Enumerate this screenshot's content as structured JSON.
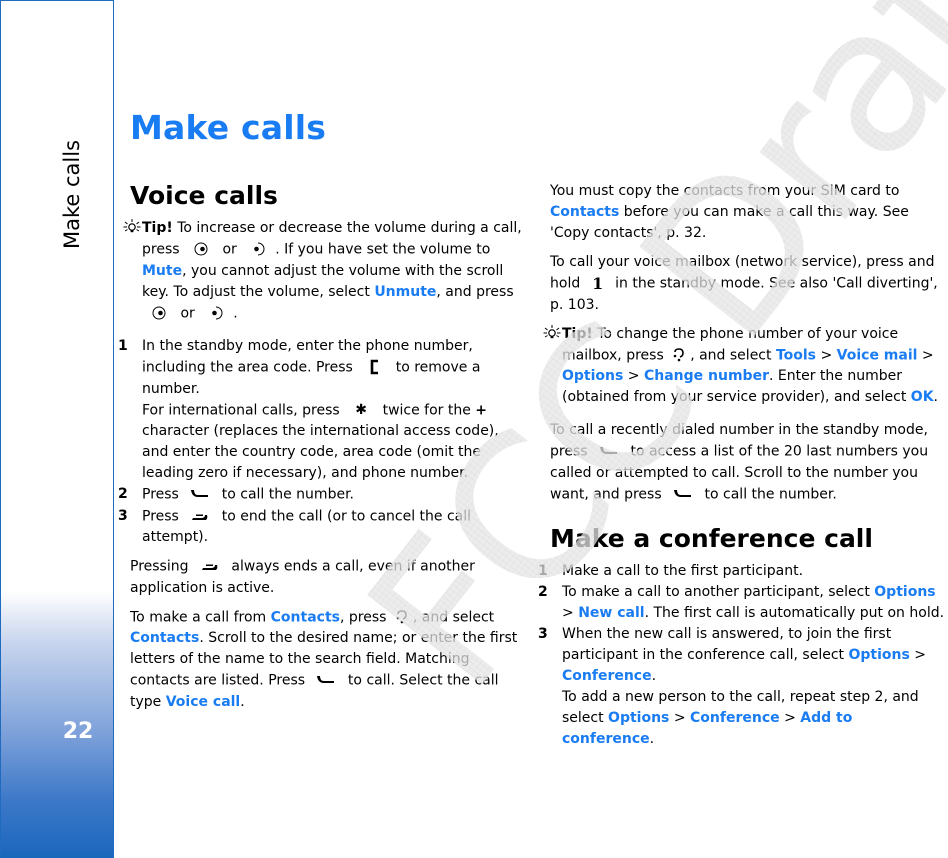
{
  "sidebar": {
    "chapter_title": "Make calls",
    "page_number": "22",
    "accent_color": "#1a66bd"
  },
  "page": {
    "title": "Make calls",
    "link_color": "#1a7cf2"
  },
  "watermark": {
    "text": "FCC Draft"
  },
  "left": {
    "heading": "Voice calls",
    "tip": {
      "icon": "lightbulb-icon",
      "label": "Tip!",
      "t1": " To increase or decrease the volume during a call, press ",
      "t2": " or ",
      "t3": ". If you have set the volume to ",
      "mute": "Mute",
      "t4": ", you cannot adjust the volume with the scroll key. To adjust the volume, select ",
      "unmute": "Unmute",
      "t5": ", and press ",
      "t6": " or ",
      "t7": "."
    },
    "steps": [
      {
        "num": "1",
        "a": "In the standby mode, enter the phone number, including the area code. Press ",
        "b": " to remove a number.",
        "c": "For international calls, press ",
        "d": " twice for the ",
        "plus": "+",
        "e": " character (replaces the international access code), and enter the country code, area code (omit the leading zero if necessary), and phone number."
      },
      {
        "num": "2",
        "a": "Press ",
        "b": " to call the number."
      },
      {
        "num": "3",
        "a": "Press ",
        "b": " to end the call (or to cancel the call attempt)."
      }
    ],
    "p_pressing": {
      "a": "Pressing ",
      "b": " always ends a call, even if another application is active."
    },
    "p_contacts": {
      "a": "To make a call from ",
      "contacts1": "Contacts",
      "b": ", press ",
      "c": ", and select ",
      "contacts2": "Contacts",
      "d": ". Scroll to the desired name; or enter the first letters of the name to the search field. Matching contacts are listed. Press ",
      "e": " to call. Select the call type ",
      "voice_call": "Voice call",
      "f": "."
    }
  },
  "right": {
    "p_sim": {
      "a": "You must copy the contacts from your SIM card to ",
      "contacts": "Contacts",
      "b": " before you can make a call this way. See 'Copy contacts', p. 32."
    },
    "p_mailbox": {
      "a": "To call your voice mailbox (network service), press and hold ",
      "key": "1",
      "b": " in the standby mode. See also 'Call diverting', p. 103."
    },
    "tip": {
      "label": "Tip!",
      "a": " To change the phone number of your voice mailbox, press ",
      "b": ", and select ",
      "tools": "Tools",
      "sep1": " > ",
      "voice_mail": "Voice mail",
      "sep2": " > ",
      "options": "Options",
      "sep3": " > ",
      "change_number": "Change number",
      "c": ". Enter the number (obtained from your service provider), and select ",
      "ok": "OK",
      "d": "."
    },
    "p_recent": {
      "a": "To call a recently dialed number in the standby mode, press ",
      "b": " to access a list of the 20 last numbers you called or attempted to call. Scroll to the number you want, and press ",
      "c": " to call the number."
    },
    "heading": "Make a conference call",
    "steps": [
      {
        "num": "1",
        "a": "Make a call to the first participant."
      },
      {
        "num": "2",
        "a": "To make a call to another participant, select ",
        "options": "Options",
        "sep": " > ",
        "new_call": "New call",
        "b": ". The first call is automatically put on hold."
      },
      {
        "num": "3",
        "a": "When the new call is answered, to join the first participant in the conference call, select ",
        "options": "Options",
        "sep": " > ",
        "conference": "Conference",
        "b": ".",
        "c": "To add a new person to the call, repeat step 2, and select ",
        "options2": "Options",
        "sep2": " > ",
        "conference2": "Conference",
        "sep3": " > ",
        "add": "Add to conference",
        "d": "."
      }
    ]
  }
}
